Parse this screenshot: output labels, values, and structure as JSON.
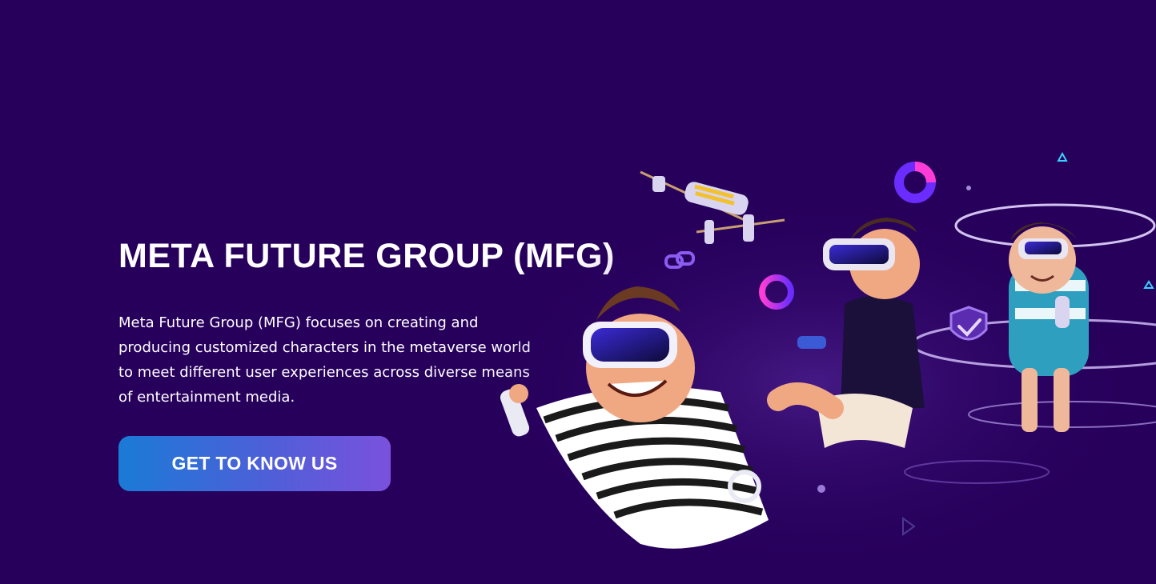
{
  "hero": {
    "title": "META FUTURE GROUP (MFG)",
    "description": "Meta Future Group (MFG) focuses on creating and producing customized characters in the metaverse world to meet different user experiences across diverse means of entertainment media.",
    "cta_label": "GET TO KNOW US"
  },
  "colors": {
    "background": "#27005c",
    "button_gradient_start": "#1a7bd6",
    "button_gradient_end": "#7a52dc",
    "text": "#ffffff"
  },
  "illustration": {
    "subject": "vr-characters-illustration"
  }
}
